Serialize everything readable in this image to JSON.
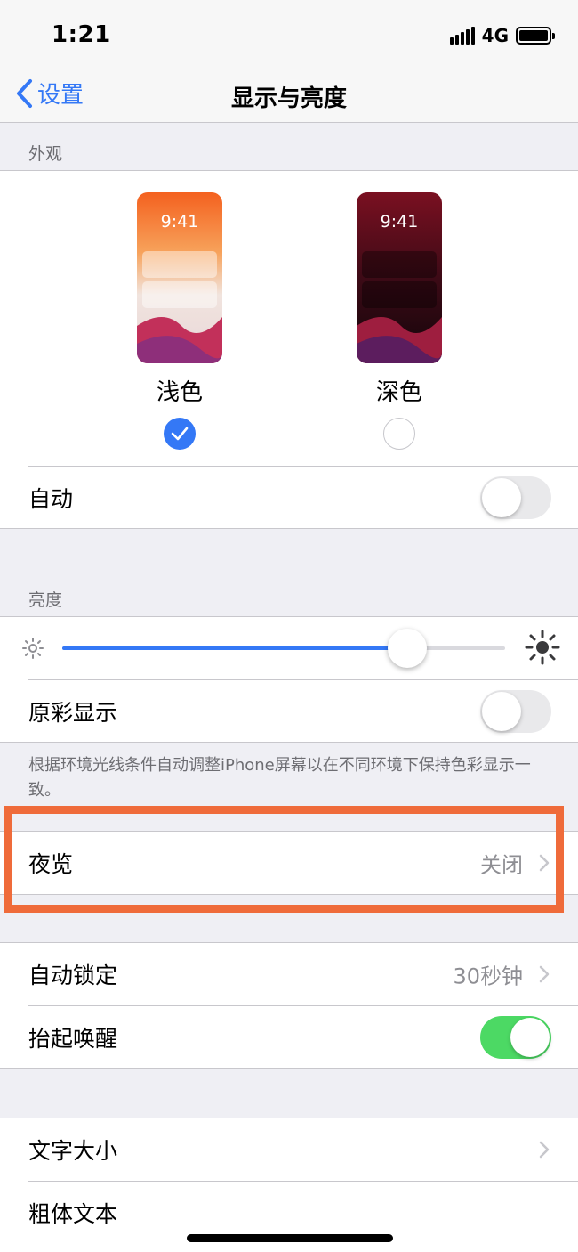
{
  "status_bar": {
    "time": "1:21",
    "network": "4G"
  },
  "nav": {
    "back_label": "设置",
    "title": "显示与亮度"
  },
  "appearance": {
    "header": "外观",
    "light": {
      "time": "9:41",
      "label": "浅色",
      "selected": true
    },
    "dark": {
      "time": "9:41",
      "label": "深色",
      "selected": false
    },
    "auto_label": "自动",
    "auto_on": false
  },
  "brightness": {
    "header": "亮度",
    "level": 0.78,
    "true_tone_label": "原彩显示",
    "true_tone_on": false,
    "footnote": "根据环境光线条件自动调整iPhone屏幕以在不同环境下保持色彩显示一致。"
  },
  "night_shift": {
    "label": "夜览",
    "value": "关闭"
  },
  "lock": {
    "auto_lock_label": "自动锁定",
    "auto_lock_value": "30秒钟",
    "raise_to_wake_label": "抬起唤醒",
    "raise_to_wake_on": true
  },
  "text": {
    "text_size_label": "文字大小",
    "bold_text_label": "粗体文本"
  },
  "colors": {
    "accent": "#3478f6",
    "toggle_on": "#4cd964",
    "highlight": "#ef6b3a"
  }
}
